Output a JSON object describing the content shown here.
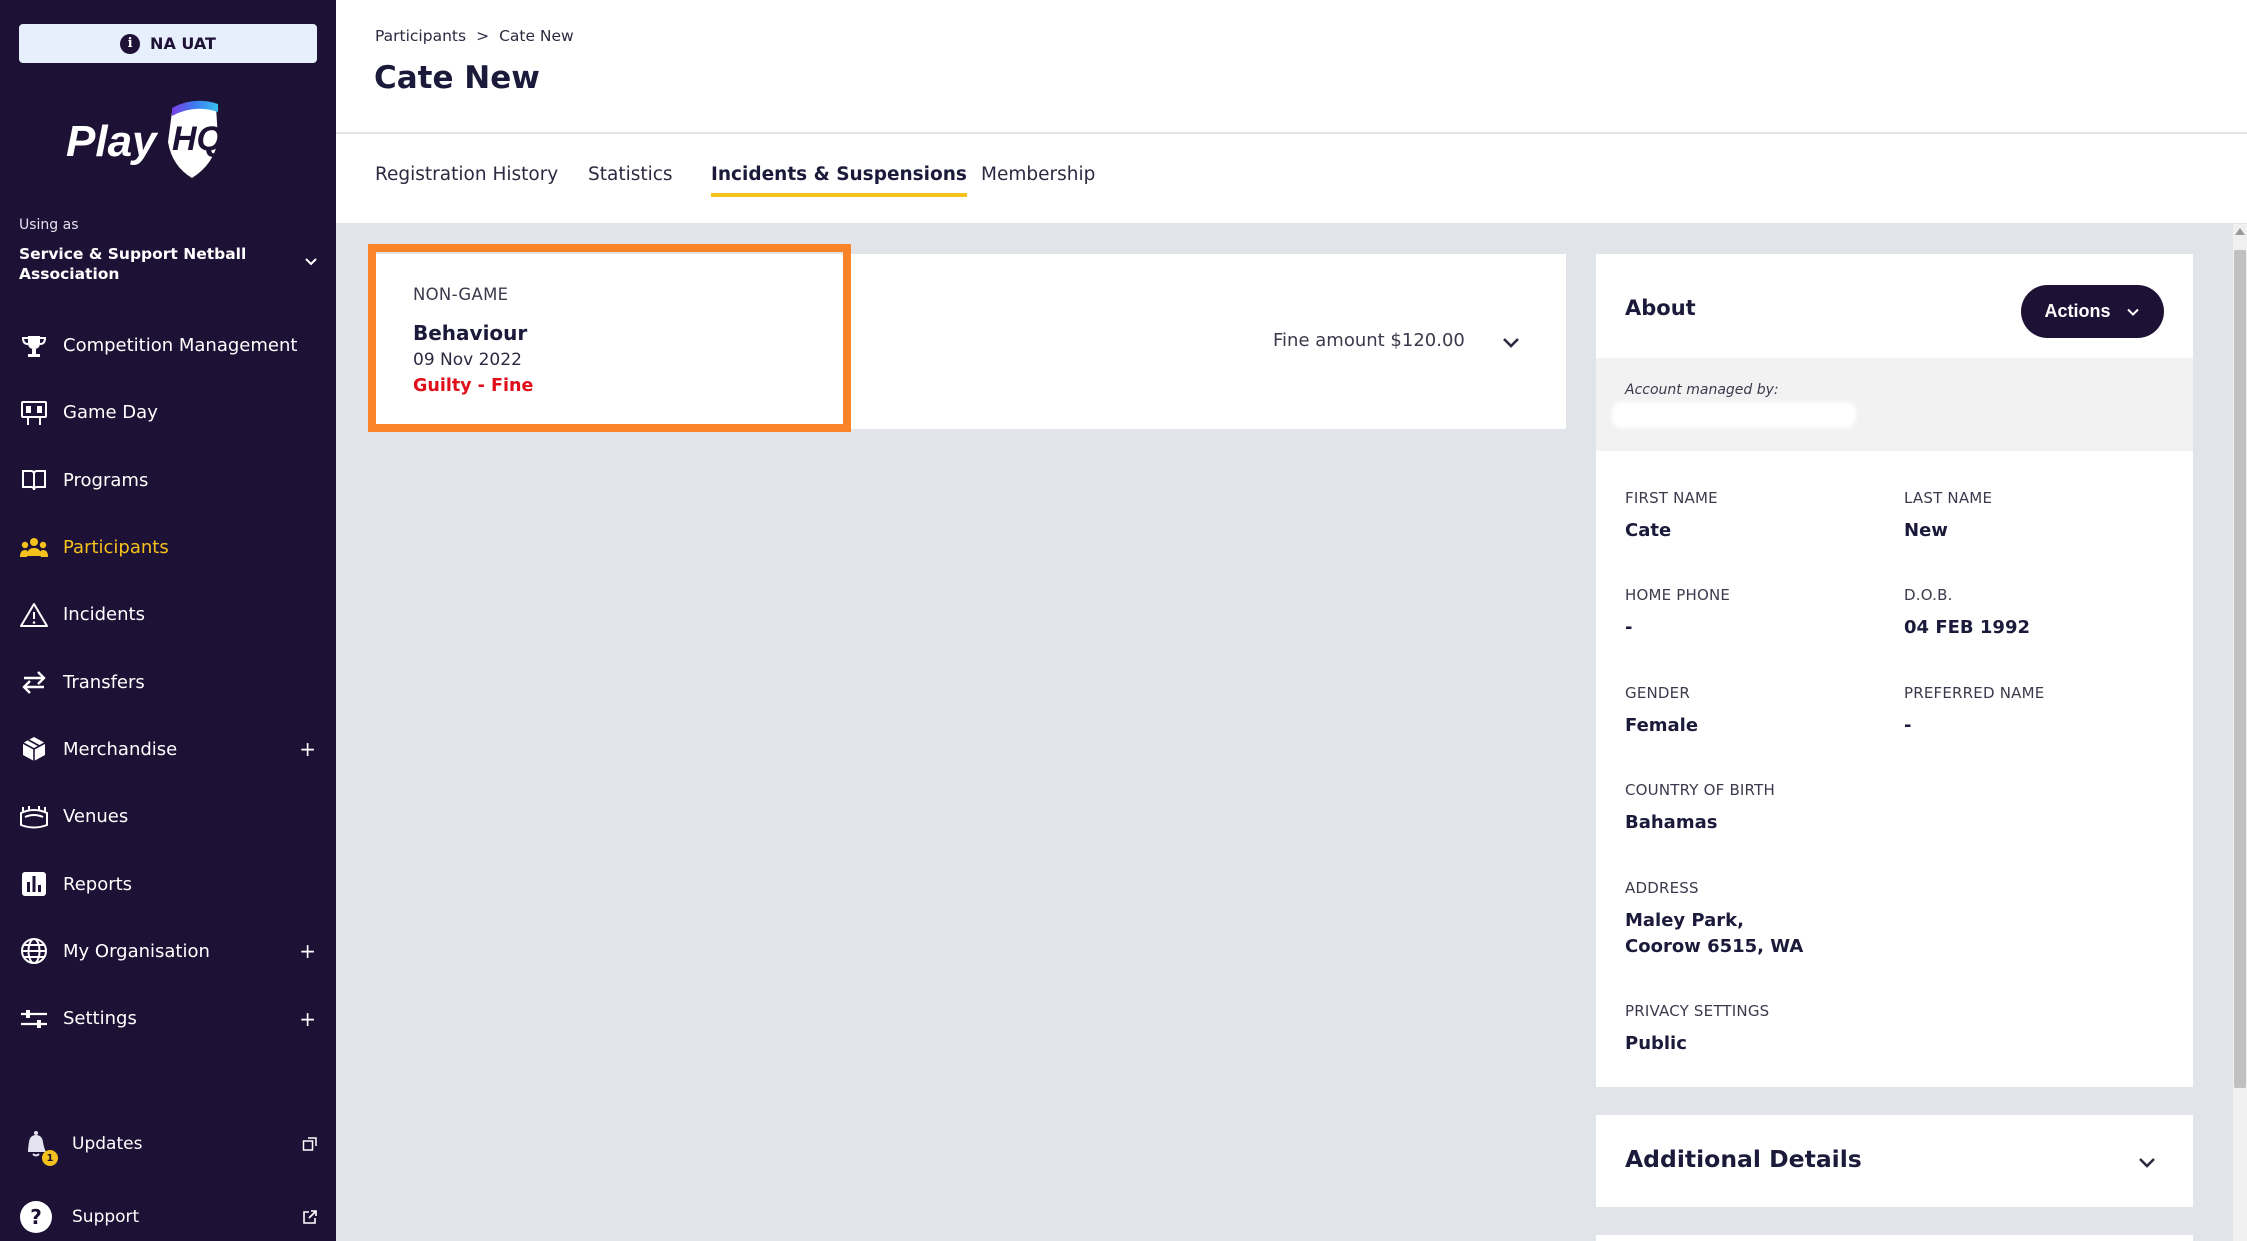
{
  "sidebar": {
    "env_label": "NA UAT",
    "logo_text": "PlayHQ",
    "using_as_label": "Using as",
    "org_name": "Service & Support Netball Association",
    "nav": [
      {
        "label": "Competition Management",
        "icon": "trophy-icon",
        "active": false,
        "expandable": false
      },
      {
        "label": "Game Day",
        "icon": "scoreboard-icon",
        "active": false,
        "expandable": false
      },
      {
        "label": "Programs",
        "icon": "book-icon",
        "active": false,
        "expandable": false
      },
      {
        "label": "Participants",
        "icon": "people-icon",
        "active": true,
        "expandable": false
      },
      {
        "label": "Incidents",
        "icon": "warning-icon",
        "active": false,
        "expandable": false
      },
      {
        "label": "Transfers",
        "icon": "transfer-arrows-icon",
        "active": false,
        "expandable": false
      },
      {
        "label": "Merchandise",
        "icon": "box-icon",
        "active": false,
        "expandable": true
      },
      {
        "label": "Venues",
        "icon": "stadium-icon",
        "active": false,
        "expandable": false
      },
      {
        "label": "Reports",
        "icon": "reports-icon",
        "active": false,
        "expandable": false
      },
      {
        "label": "My Organisation",
        "icon": "globe-icon",
        "active": false,
        "expandable": true
      },
      {
        "label": "Settings",
        "icon": "sliders-icon",
        "active": false,
        "expandable": true
      }
    ],
    "updates_label": "Updates",
    "updates_badge": "1",
    "support_label": "Support",
    "accent_color": "#f5c21d",
    "background_color": "#1d1235"
  },
  "header": {
    "breadcrumb_root": "Participants",
    "breadcrumb_separator": ">",
    "breadcrumb_current": "Cate New",
    "title": "Cate New"
  },
  "tabs": [
    {
      "label": "Registration History",
      "active": false
    },
    {
      "label": "Statistics",
      "active": false
    },
    {
      "label": "Incidents & Suspensions",
      "active": true
    },
    {
      "label": "Membership",
      "active": false
    }
  ],
  "incident": {
    "type": "NON-GAME",
    "title": "Behaviour",
    "date": "09 Nov 2022",
    "status": "Guilty - Fine",
    "fine": "Fine amount $120.00",
    "status_color": "#e0101b",
    "highlight_color": "#f98328"
  },
  "about": {
    "title": "About",
    "actions_label": "Actions",
    "managed_by_label": "Account managed by:",
    "fields": {
      "first_name": {
        "label": "FIRST NAME",
        "value": "Cate"
      },
      "last_name": {
        "label": "LAST NAME",
        "value": "New"
      },
      "home_phone": {
        "label": "HOME PHONE",
        "value": "-"
      },
      "dob": {
        "label": "D.O.B.",
        "value": "04 FEB 1992"
      },
      "gender": {
        "label": "GENDER",
        "value": "Female"
      },
      "preferred_name": {
        "label": "PREFERRED NAME",
        "value": "-"
      },
      "country": {
        "label": "COUNTRY OF BIRTH",
        "value": "Bahamas"
      },
      "address": {
        "label": "ADDRESS",
        "line1": "Maley Park,",
        "line2": "Coorow 6515, WA"
      },
      "privacy": {
        "label": "PRIVACY SETTINGS",
        "value": "Public"
      }
    }
  },
  "additional": {
    "title": "Additional Details"
  }
}
